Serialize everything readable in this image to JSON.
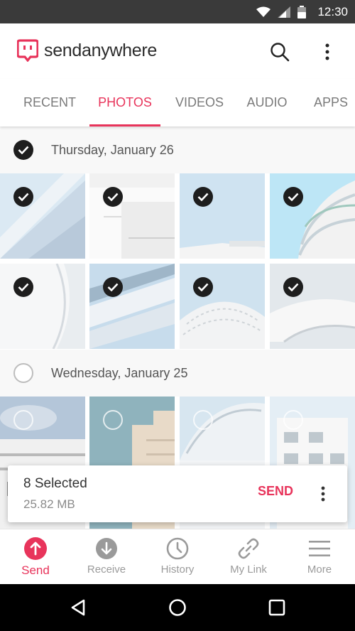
{
  "status_bar": {
    "time": "12:30"
  },
  "app": {
    "logo_prefix": "send",
    "logo_suffix": "anywhere",
    "brand_color": "#e8345b"
  },
  "tabs": [
    {
      "label": "RECENT",
      "active": false
    },
    {
      "label": "PHOTOS",
      "active": true
    },
    {
      "label": "VIDEOS",
      "active": false
    },
    {
      "label": "AUDIO",
      "active": false
    },
    {
      "label": "APPS",
      "active": false
    }
  ],
  "sections": [
    {
      "title": "Thursday, January 26",
      "all_selected": true
    },
    {
      "title": "Wednesday, January 25",
      "all_selected": false
    }
  ],
  "selection": {
    "count_text": "8 Selected",
    "size_text": "25.82 MB",
    "send_label": "SEND"
  },
  "bottom_nav": [
    {
      "label": "Send",
      "icon": "upload-icon",
      "active": true
    },
    {
      "label": "Receive",
      "icon": "download-icon",
      "active": false
    },
    {
      "label": "History",
      "icon": "clock-icon",
      "active": false
    },
    {
      "label": "My Link",
      "icon": "link-icon",
      "active": false
    },
    {
      "label": "More",
      "icon": "hamburger-icon",
      "active": false
    }
  ]
}
